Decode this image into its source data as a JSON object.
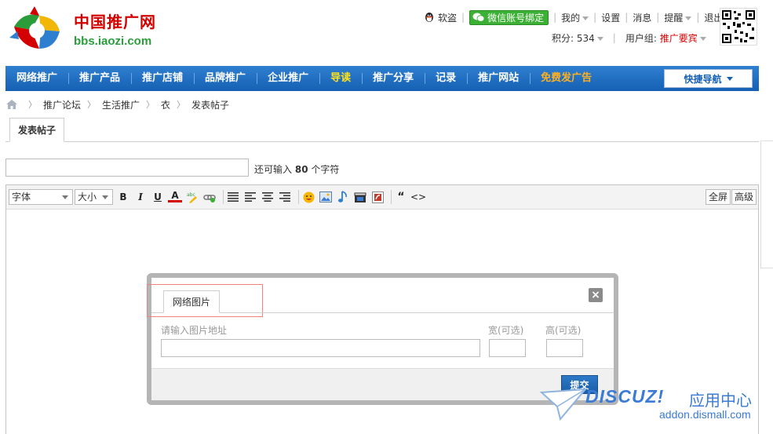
{
  "site": {
    "title": "中国推广网",
    "url": "bbs.iaozi.com"
  },
  "topbar": {
    "qq_label": "软盗",
    "wechat_label": "微信账号绑定",
    "my_label": "我的",
    "settings_label": "设置",
    "messages_label": "消息",
    "reminders_label": "提醒",
    "logout_label": "退出"
  },
  "userbar": {
    "points_label": "积分: 534",
    "usergroup_prefix": "用户组:",
    "usergroup_value": "推广要宾"
  },
  "nav": {
    "items": [
      "网络推广",
      "推广产品",
      "推广店铺",
      "品牌推广",
      "企业推广",
      "导读",
      "推广分享",
      "记录",
      "推广网站",
      "免费发广告"
    ],
    "quicknav_label": "快捷导航"
  },
  "breadcrumb": [
    "推广论坛",
    "生活推广",
    "衣",
    "发表帖子"
  ],
  "tab": {
    "label": "发表帖子"
  },
  "subject": {
    "value": "",
    "hint_prefix": "还可输入",
    "hint_count": "80",
    "hint_suffix": "个字符"
  },
  "toolbar": {
    "font_label": "字体",
    "size_label": "大小",
    "bold": "B",
    "italic": "I",
    "underline": "U",
    "color": "A",
    "quote": "“",
    "code": "<>",
    "fullscreen_label": "全屏",
    "advanced_label": "高级"
  },
  "dialog": {
    "tab_label": "网络图片",
    "close_label": "×",
    "url_label": "请输入图片地址",
    "width_label": "宽(可选)",
    "height_label": "高(可选)",
    "url_value": "",
    "width_value": "",
    "height_value": "",
    "submit_label": "提交"
  },
  "watermark": {
    "brand": "DISCUZ!",
    "cn": "应用中心",
    "url": "addon.dismall.com"
  },
  "colors": {
    "nav_bg": "#1560b3",
    "brand_red": "#d40000",
    "brand_green": "#2a9d3a",
    "wechat_green": "#3cb034",
    "submit_blue": "#1a5ea8"
  }
}
